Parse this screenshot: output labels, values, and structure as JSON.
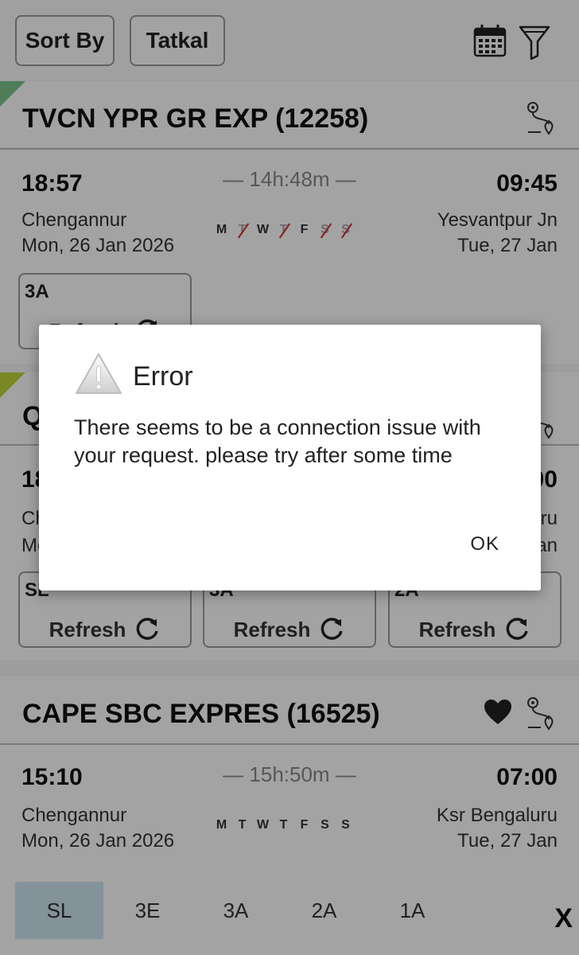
{
  "topbar": {
    "sort_label": "Sort By",
    "tatkal_label": "Tatkal"
  },
  "trains": [
    {
      "name": "TVCN YPR GR EXP",
      "number": "(12258)",
      "dep_time": "18:57",
      "arr_time": "09:45",
      "duration": "— 14h:48m —",
      "from": "Chengannur",
      "to": "Yesvantpur Jn",
      "dep_date": "Mon, 26 Jan  2026",
      "arr_date": "Tue, 27 Jan",
      "days": [
        {
          "d": "M",
          "off": false
        },
        {
          "d": "T",
          "off": true
        },
        {
          "d": "W",
          "off": false
        },
        {
          "d": "T",
          "off": true
        },
        {
          "d": "F",
          "off": false
        },
        {
          "d": "S",
          "off": true
        },
        {
          "d": "S",
          "off": true
        }
      ],
      "classes": [
        {
          "code": "3A",
          "label": "Refresh"
        }
      ],
      "corner_color": "#7cc48a"
    },
    {
      "name": "Q",
      "number": "",
      "dep_time": "18",
      "arr_time": "00",
      "from": "Ch",
      "to": "ru",
      "dep_date": "Mo",
      "arr_date": "an",
      "classes": [
        {
          "code": "SL",
          "label": "Refresh"
        },
        {
          "code": "3A",
          "label": "Refresh"
        },
        {
          "code": "2A",
          "label": "Refresh"
        }
      ],
      "corner_color": "#bfd43a"
    },
    {
      "name": "CAPE SBC EXPRES",
      "number": "(16525)",
      "dep_time": "15:10",
      "arr_time": "07:00",
      "duration": "— 15h:50m —",
      "from": "Chengannur",
      "to": "Ksr Bengaluru",
      "dep_date": "Mon, 26 Jan  2026",
      "arr_date": "Tue, 27 Jan",
      "days": [
        {
          "d": "M",
          "off": false
        },
        {
          "d": "T",
          "off": false
        },
        {
          "d": "W",
          "off": false
        },
        {
          "d": "T",
          "off": false
        },
        {
          "d": "F",
          "off": false
        },
        {
          "d": "S",
          "off": false
        },
        {
          "d": "S",
          "off": false
        }
      ]
    }
  ],
  "class_tabs": [
    "SL",
    "3E",
    "3A",
    "2A",
    "1A"
  ],
  "close_label": "X",
  "dialog": {
    "title": "Error",
    "message": "There seems to be a connection issue with your request. please try after some time",
    "ok_label": "OK"
  }
}
